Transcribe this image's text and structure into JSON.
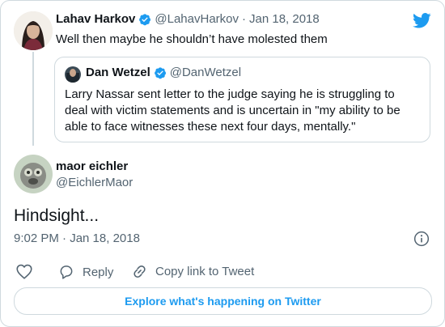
{
  "parent_tweet": {
    "author_name": "Lahav Harkov",
    "handle": "@LahavHarkov",
    "separator": "·",
    "date": "Jan 18, 2018",
    "text": "Well then maybe he shouldn’t have molested them"
  },
  "quoted_tweet": {
    "author_name": "Dan Wetzel",
    "handle": "@DanWetzel",
    "text": "Larry Nassar sent letter to the judge saying he is struggling to deal with victim statements and is uncertain in \"my ability to be able to face witnesses these next four days, mentally.\""
  },
  "main_tweet": {
    "author_name": "maor eichler",
    "handle": "@EichlerMaor",
    "text": "Hindsight...",
    "timestamp": "9:02 PM · Jan 18, 2018"
  },
  "actions": {
    "reply_label": "Reply",
    "copy_link_label": "Copy link to Tweet"
  },
  "footer": {
    "explore_label": "Explore what's happening on Twitter"
  },
  "icons": {
    "brand": "twitter-bird-icon",
    "verified": "verified-badge-icon",
    "info": "info-icon",
    "like": "heart-icon",
    "reply": "reply-icon",
    "link": "link-icon"
  },
  "colors": {
    "accent": "#1d9bf0",
    "muted_text": "#536471",
    "border": "#cfd9de"
  }
}
